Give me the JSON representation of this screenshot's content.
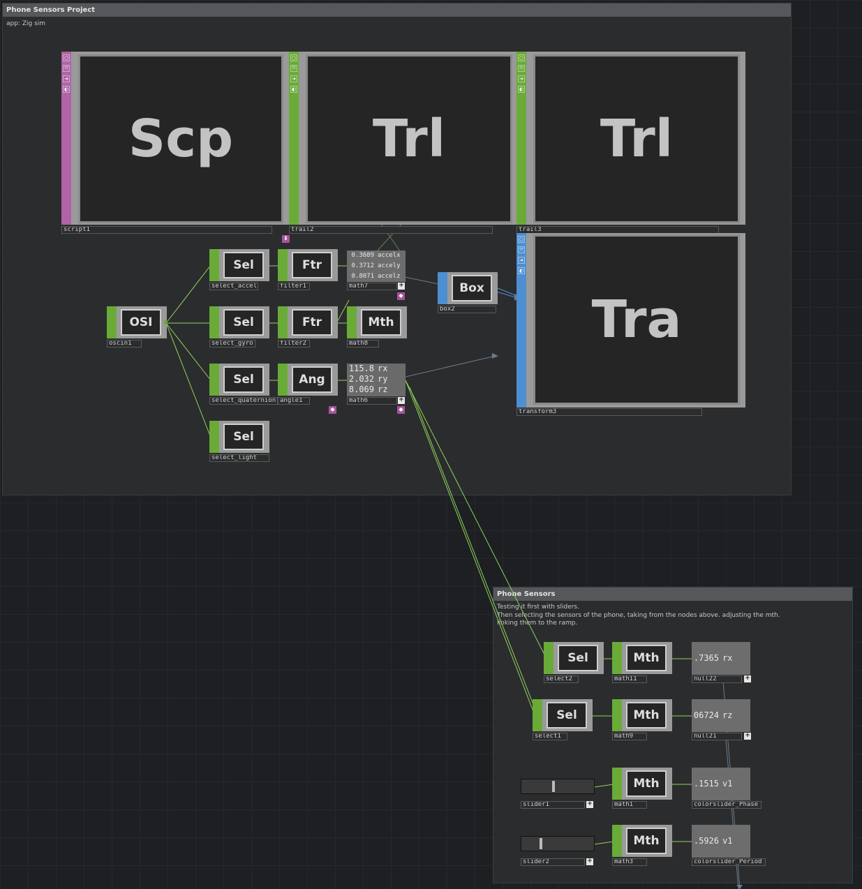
{
  "annotations": {
    "project": {
      "title": "Phone Sensors Project",
      "text": "app: Zig sim"
    },
    "sensors": {
      "title": "Phone Sensors",
      "text": "Testing it first with sliders.\nThen selecting the sensors of the phone, taking from the nodes above. adjusting the mth.\nlinking them to the ramp."
    }
  },
  "nodes": {
    "script1": {
      "label": "script1",
      "glyph": "Scp"
    },
    "trail2": {
      "label": "trail2",
      "glyph": "Trl"
    },
    "trail3": {
      "label": "trail3",
      "glyph": "Trl"
    },
    "transform3": {
      "label": "transform3",
      "glyph": "Tra"
    },
    "oscin1": {
      "label": "oscin1",
      "glyph": "OSI"
    },
    "select_accel": {
      "label": "select_accel",
      "glyph": "Sel"
    },
    "select_gyro": {
      "label": "select_gyro",
      "glyph": "Sel"
    },
    "select_quaternion": {
      "label": "select_quaternion",
      "glyph": "Sel"
    },
    "select_light": {
      "label": "select_light",
      "glyph": "Sel"
    },
    "filter1": {
      "label": "filter1",
      "glyph": "Ftr"
    },
    "filter2": {
      "label": "filter2",
      "glyph": "Ftr"
    },
    "angle1": {
      "label": "angle1",
      "glyph": "Ang"
    },
    "math7": {
      "label": "math7",
      "rows": [
        {
          "value": "0.3689",
          "name": "accelx"
        },
        {
          "value": "0.3712",
          "name": "accely"
        },
        {
          "value": "0.8071",
          "name": "accelz"
        }
      ]
    },
    "math8": {
      "label": "math8",
      "glyph": "Mth"
    },
    "math6": {
      "label": "math6",
      "rows": [
        {
          "value": "115.8",
          "name": "rx"
        },
        {
          "value": "2.032",
          "name": "ry"
        },
        {
          "value": "8.069",
          "name": "rz"
        }
      ]
    },
    "box2": {
      "label": "box2",
      "glyph": "Box"
    },
    "select2": {
      "label": "select2",
      "glyph": "Sel"
    },
    "select1": {
      "label": "select1",
      "glyph": "Sel"
    },
    "math11": {
      "label": "math11",
      "glyph": "Mth"
    },
    "math9": {
      "label": "math9",
      "glyph": "Mth"
    },
    "math1": {
      "label": "math1",
      "glyph": "Mth"
    },
    "math3": {
      "label": "math3",
      "glyph": "Mth"
    },
    "null22": {
      "label": "null22",
      "value": ".7365",
      "name": "rx"
    },
    "null21": {
      "label": "null21",
      "value": "06724",
      "name": "rz"
    },
    "colorslider_phase": {
      "label": "colorslider_Phase",
      "value": ".1515",
      "name": "v1"
    },
    "colorslider_period": {
      "label": "colorslider_Period",
      "value": ".5926",
      "name": "v1"
    },
    "slider1": {
      "label": "slider1",
      "level": 0.42
    },
    "slider2": {
      "label": "slider2",
      "level": 0.25
    }
  },
  "colors": {
    "chop": "#6aab38",
    "dat": "#b063a6",
    "sop": "#4d8fd0",
    "wire": "#8fd35a",
    "wire_sop": "#5d7080"
  },
  "icons": [
    "plus-icon",
    "bypass-icon",
    "lock-icon",
    "viewer-icon",
    "clone-icon"
  ]
}
